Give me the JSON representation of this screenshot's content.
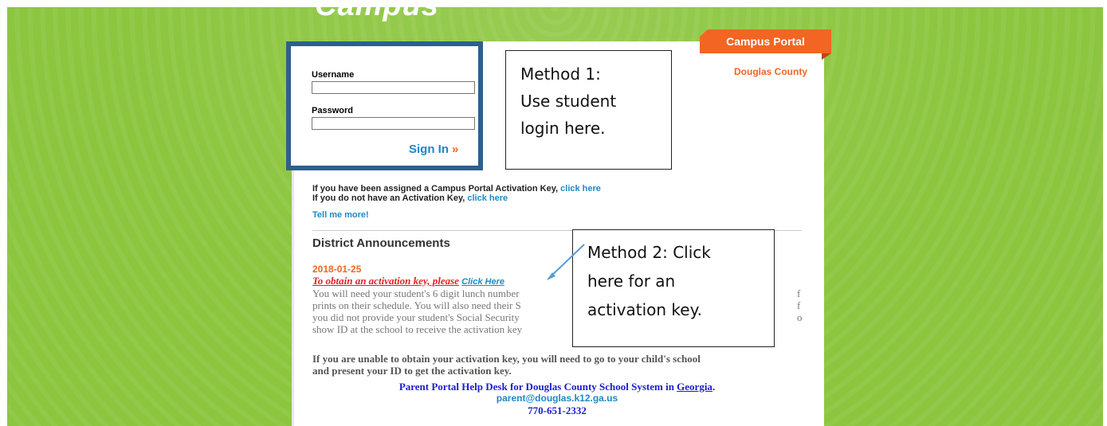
{
  "header": {
    "logo_text": "Campus",
    "ribbon_label": "Campus Portal",
    "district": "Douglas County"
  },
  "login": {
    "username_label": "Username",
    "username_value": "",
    "password_label": "Password",
    "password_value": "",
    "signin_label": "Sign In",
    "signin_chevron": "»"
  },
  "callouts": {
    "method1": [
      "Method 1:",
      "Use student",
      "login here."
    ],
    "method2": [
      "Method 2: Click",
      "here for an",
      "activation key."
    ]
  },
  "activation": {
    "line1_prefix": "If you have been assigned a Campus Portal Activation Key,",
    "line1_link": "click here",
    "line2_prefix": "If you do not have an Activation Key,",
    "line2_link": "click here",
    "tell_more": "Tell me more!"
  },
  "announcements": {
    "heading": "District Announcements",
    "date": "2018-01-25",
    "title": "To obtain an activation key, please",
    "title_link": "Click Here",
    "body_lines": [
      "You will need your student's 6 digit lunch number",
      "prints on their schedule. You will also need their S",
      "you did not provide your student's Social Security",
      "show ID at the school to receive the activation key"
    ],
    "body_tail_right": [
      "f",
      "f",
      "o"
    ],
    "bold_lines": [
      "If you are unable to obtain your activation key, you will need to go to your child's school",
      "and present your ID to get the activation key."
    ],
    "helpdesk_prefix": "Parent Portal Help Desk for Douglas County School System in",
    "helpdesk_state": "Georgia",
    "email": "parent@douglas.k12.ga.us",
    "phone": "770-651-2332"
  },
  "colors": {
    "background": "#8cc63f",
    "accent": "#f26522",
    "login_border": "#2e5f8e",
    "link": "#1f88c6"
  }
}
